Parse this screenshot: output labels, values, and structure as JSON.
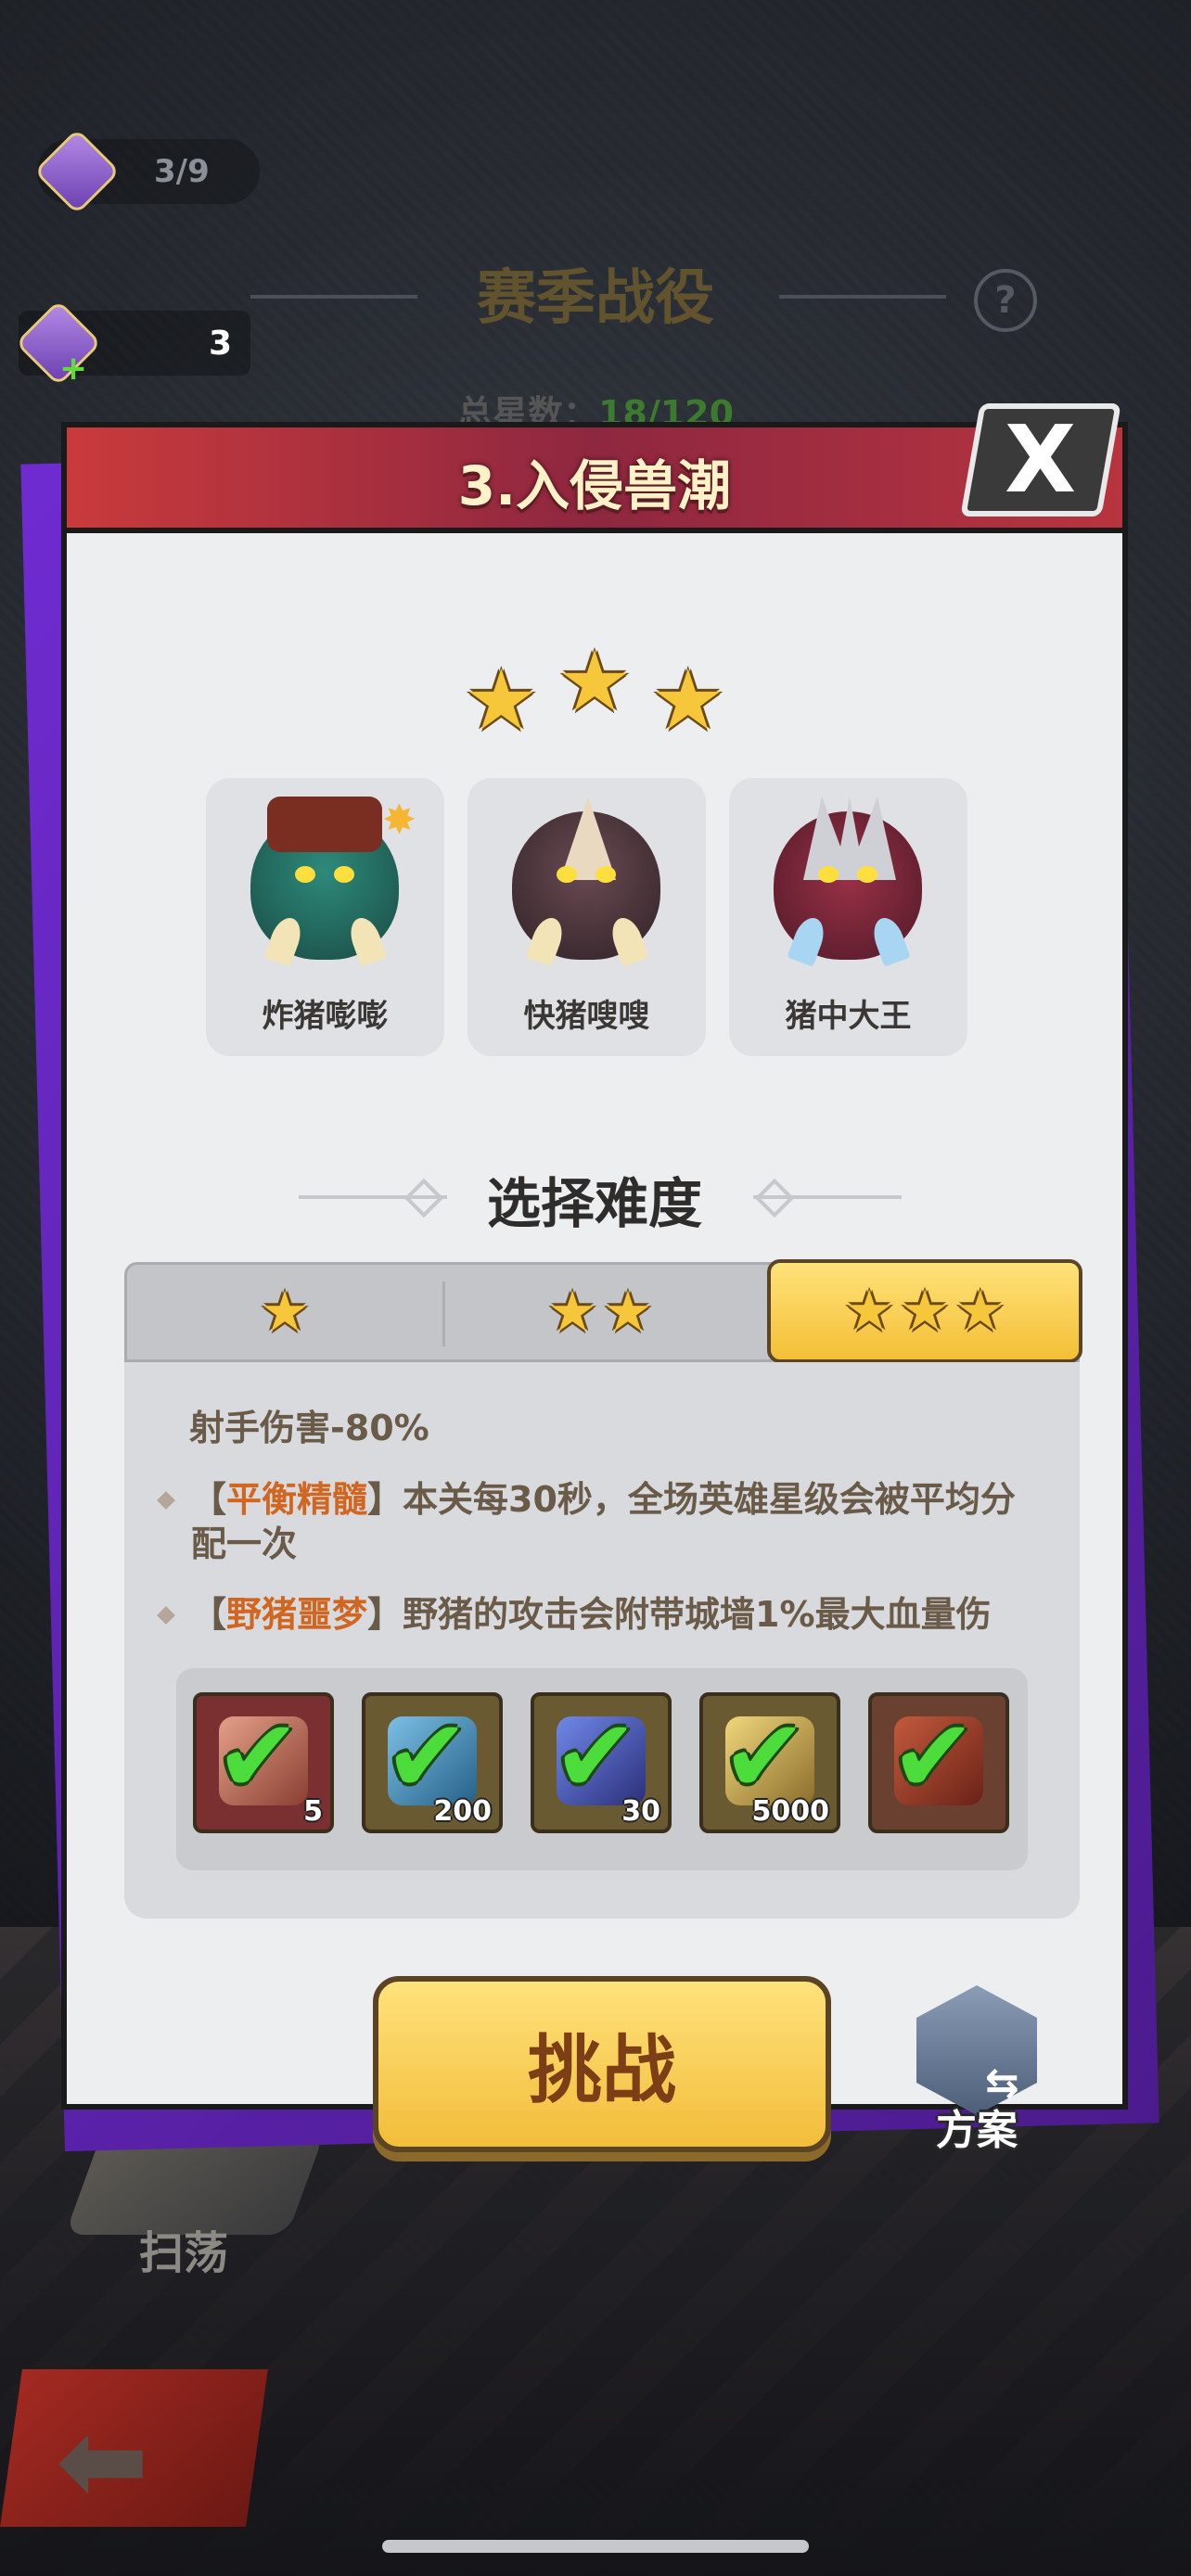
{
  "hud": {
    "top_counter": "3/9",
    "resource_count": "3",
    "season_title": "赛季战役",
    "stars_total_label": "总星数：",
    "stars_total_value": "18/120"
  },
  "dialog": {
    "title": "3.入侵兽潮",
    "close_label": "X",
    "earned_stars": 3,
    "bosses": [
      {
        "name": "炸猪嘭嘭",
        "icon": "bomb-boar-icon"
      },
      {
        "name": "快猪嗖嗖",
        "icon": "swift-boar-icon"
      },
      {
        "name": "猪中大王",
        "icon": "boar-king-icon"
      }
    ],
    "difficulty_title": "选择难度",
    "difficulty_tabs": [
      {
        "stars": "★",
        "selected": false
      },
      {
        "stars": "★★",
        "selected": false
      },
      {
        "stars": "★★★",
        "selected": true
      }
    ],
    "difficulty_effect": "射手伤害-80%",
    "rules": [
      {
        "prefix": "【",
        "keyword": "平衡精髓",
        "suffix": "】",
        "text": "本关每30秒，全场英雄星级会被平均分配一次"
      },
      {
        "prefix": "【",
        "keyword": "野猪噩梦",
        "suffix": "】",
        "text": "野猪的攻击会附带城墙1%最大血量伤"
      }
    ],
    "rewards": [
      {
        "icon": "ore-icon",
        "qty": "5",
        "claimed": true
      },
      {
        "icon": "diamond-icon",
        "qty": "200",
        "claimed": true
      },
      {
        "icon": "crystal-icon",
        "qty": "30",
        "claimed": true
      },
      {
        "icon": "winged-medal-icon",
        "qty": "5000",
        "claimed": true
      },
      {
        "icon": "skill-book-icon",
        "qty": "",
        "claimed": true
      }
    ],
    "challenge_label": "挑战",
    "plan_label": "方案"
  },
  "background": {
    "sweep_label": "扫荡"
  },
  "colors": {
    "header_red": "#c93a3c",
    "gold": "#f6c73a",
    "keyword_orange": "#d0661f",
    "check_green": "#4cdc3c",
    "purple_shadow": "#6f2bd0"
  }
}
